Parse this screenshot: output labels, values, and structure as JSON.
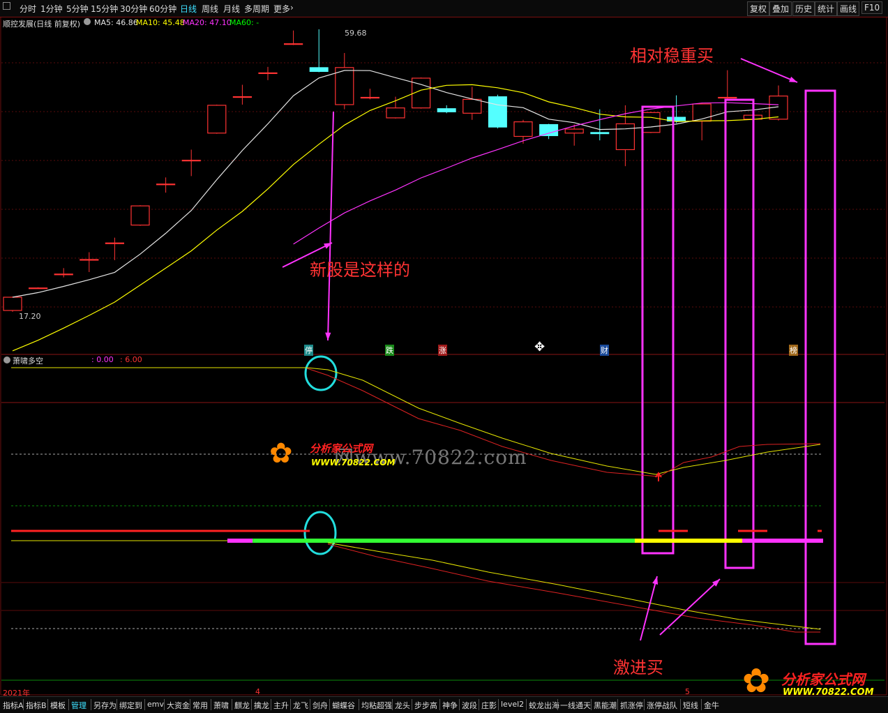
{
  "toolbar": {
    "periods": [
      "分时",
      "1分钟",
      "5分钟",
      "15分钟",
      "30分钟",
      "60分钟",
      "日线",
      "周线",
      "月线",
      "多周期",
      "更多"
    ],
    "active_period": "日线",
    "right_buttons": [
      "复权",
      "叠加",
      "历史",
      "统计",
      "画线",
      "F10"
    ]
  },
  "info": {
    "stock_title": "顺控发展(日线 前复权)",
    "ma5": "MA5: 46.86",
    "ma10": "MA10: 45.48",
    "ma20": "MA20: 47.10",
    "ma60": "MA60: -"
  },
  "price_labels": {
    "high": "59.68",
    "low": "17.20"
  },
  "markers": [
    "停",
    "跌",
    "涨",
    "财",
    "榜"
  ],
  "indicator": {
    "name": "萧啸多空",
    "v1": ": 0.00",
    "v2": ": 6.00"
  },
  "annotations": {
    "top_right": "相对稳重买",
    "middle": "新股是这样的",
    "bottom": "激进买"
  },
  "time_axis": [
    "2021年",
    "4",
    "5"
  ],
  "bottom_tabs": [
    "指标A",
    "指标B",
    "模板",
    "管理",
    "另存为",
    "绑定到",
    "emv",
    "大资金",
    "常用",
    "萧啸",
    "麒龙",
    "擒龙",
    "主升",
    "龙飞",
    "剑舟",
    "蝴蝶谷",
    "均粘超强",
    "龙头",
    "步步高",
    "神争",
    "波段",
    "庄影",
    "level2",
    "蛟龙出海",
    "一线通天",
    "黑能潮",
    "抓涨停",
    "涨停战队",
    "短线",
    "金牛"
  ],
  "active_tab": "管理",
  "watermark": {
    "site": "分析家公式网",
    "url": "WWW.70822.COM",
    "gray": "网www.70822.com"
  },
  "colors": {
    "up": "#ff3333",
    "down": "#54ffff",
    "ma5": "#e6e6e6",
    "ma10": "#ffff00",
    "ma20": "#ff33ff",
    "highlight": "#ff33ff"
  },
  "candles": [
    {
      "o": 17.2,
      "c": 19.2,
      "h": 19.3,
      "l": 17.0
    },
    {
      "o": 20.6,
      "c": 20.6,
      "h": 20.7,
      "l": 20.5
    },
    {
      "o": 22.7,
      "c": 22.7,
      "h": 23.6,
      "l": 22.2
    },
    {
      "o": 24.9,
      "c": 24.9,
      "h": 26.0,
      "l": 23.0
    },
    {
      "o": 27.4,
      "c": 27.4,
      "h": 28.2,
      "l": 24.8
    },
    {
      "o": 30.1,
      "c": 33.0,
      "h": 33.1,
      "l": 30.0
    },
    {
      "o": 36.3,
      "c": 36.3,
      "h": 37.3,
      "l": 35.0
    },
    {
      "o": 39.9,
      "c": 39.9,
      "h": 41.5,
      "l": 37.5
    },
    {
      "o": 44.0,
      "c": 48.2,
      "h": 48.3,
      "l": 43.9
    },
    {
      "o": 49.5,
      "c": 49.5,
      "h": 51.3,
      "l": 48.3
    },
    {
      "o": 53.1,
      "c": 53.1,
      "h": 54.0,
      "l": 52.0
    },
    {
      "o": 57.5,
      "c": 57.5,
      "h": 59.5,
      "l": 57.3
    },
    {
      "o": 53.9,
      "c": 53.3,
      "h": 59.68,
      "l": 53.2
    },
    {
      "o": 48.3,
      "c": 53.9,
      "h": 56.1,
      "l": 47.6
    },
    {
      "o": 49.4,
      "c": 49.4,
      "h": 50.7,
      "l": 49.1
    },
    {
      "o": 46.3,
      "c": 47.8,
      "h": 49.5,
      "l": 46.2
    },
    {
      "o": 47.8,
      "c": 52.3,
      "h": 52.4,
      "l": 47.7
    },
    {
      "o": 47.7,
      "c": 47.2,
      "h": 48.2,
      "l": 47.0
    },
    {
      "o": 47.0,
      "c": 49.1,
      "h": 51.0,
      "l": 46.0
    },
    {
      "o": 49.5,
      "c": 44.9,
      "h": 49.8,
      "l": 44.7
    },
    {
      "o": 43.5,
      "c": 45.7,
      "h": 46.0,
      "l": 42.4
    },
    {
      "o": 45.3,
      "c": 43.6,
      "h": 45.4,
      "l": 43.1
    },
    {
      "o": 44.0,
      "c": 44.6,
      "h": 45.3,
      "l": 42.1
    },
    {
      "o": 44.1,
      "c": 43.9,
      "h": 47.6,
      "l": 42.9
    },
    {
      "o": 41.5,
      "c": 45.4,
      "h": 48.2,
      "l": 39.0
    },
    {
      "o": 44.1,
      "c": 47.1,
      "h": 47.2,
      "l": 44.0
    },
    {
      "o": 46.4,
      "c": 45.8,
      "h": 49.7,
      "l": 45.5
    },
    {
      "o": 45.8,
      "c": 48.4,
      "h": 48.5,
      "l": 42.9
    },
    {
      "o": 49.3,
      "c": 49.4,
      "h": 53.5,
      "l": 49.2
    },
    {
      "o": 46.1,
      "c": 46.7,
      "h": 47.2,
      "l": 45.0
    },
    {
      "o": 46.1,
      "c": 49.6,
      "h": 51.2,
      "l": 45.9
    }
  ]
}
